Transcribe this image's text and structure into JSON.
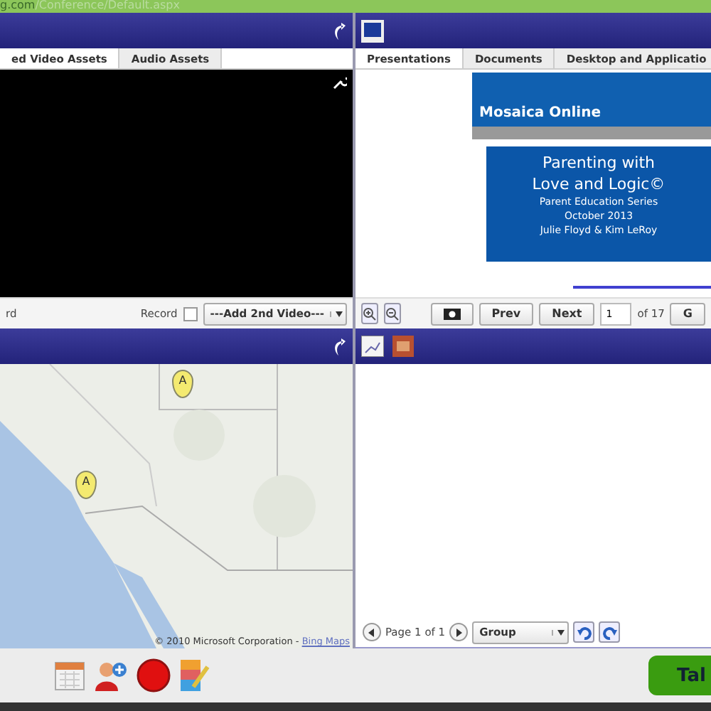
{
  "address_bar": {
    "url_host": "g.com",
    "url_path": "/Conference/Default.aspx"
  },
  "video_panel": {
    "tabs": [
      {
        "label": "ed Video Assets",
        "selected": true
      },
      {
        "label": "Audio Assets",
        "selected": false
      }
    ],
    "left_label": "rd",
    "record_label": "Record",
    "record_checked": false,
    "second_video": "---Add 2nd Video---"
  },
  "presentation_panel": {
    "tabs": [
      {
        "label": "Presentations",
        "selected": true
      },
      {
        "label": "Documents",
        "selected": false
      },
      {
        "label": "Desktop and Applicatio",
        "selected": false
      }
    ],
    "slide": {
      "banner": "Mosaica Online",
      "title_lines": [
        "Parenting with",
        "Love and Logic©"
      ],
      "subtitle_lines": [
        "Parent Education Series",
        "October 2013",
        "Julie Floyd & Kim LeRoy"
      ]
    },
    "prev": "Prev",
    "next": "Next",
    "page": "1",
    "page_total": "of 17",
    "go": "G"
  },
  "map_panel": {
    "pins": [
      {
        "label": "A"
      },
      {
        "label": "A"
      }
    ],
    "attribution": "© 2010 Microsoft Corporation - ",
    "attribution_link": "Bing Maps"
  },
  "notes_panel": {
    "pager": "Page 1 of 1",
    "group": "Group"
  },
  "bottom_bar": {
    "action_button": "Tal"
  }
}
